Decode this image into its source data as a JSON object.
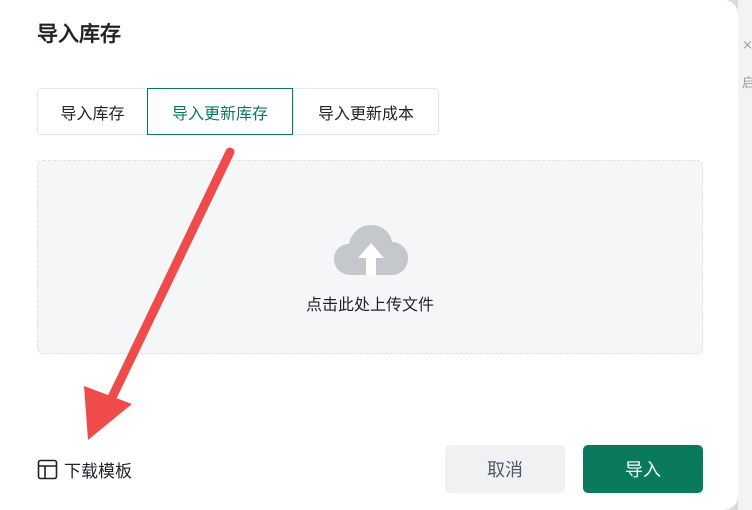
{
  "dialog": {
    "title": "导入库存"
  },
  "tabs": [
    {
      "label": "导入库存",
      "active": false
    },
    {
      "label": "导入更新库存",
      "active": true
    },
    {
      "label": "导入更新成本",
      "active": false
    }
  ],
  "upload": {
    "icon": "cloud-upload-icon",
    "hint": "点击此处上传文件"
  },
  "download_template": {
    "icon": "template-icon",
    "label": "下载模板"
  },
  "buttons": {
    "cancel": "取消",
    "import": "导入"
  },
  "background_glyphs": [
    "×",
    "启"
  ],
  "annotation": {
    "arrow_color": "#f04b4b"
  },
  "colors": {
    "accent": "#0a7a5f"
  }
}
